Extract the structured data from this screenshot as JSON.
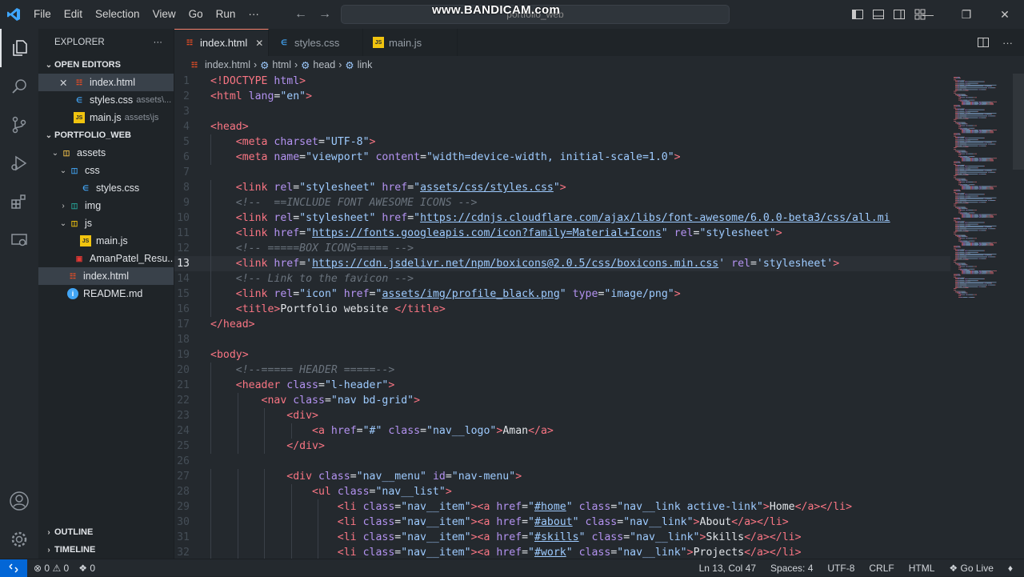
{
  "titlebar": {
    "menu": [
      "File",
      "Edit",
      "Selection",
      "View",
      "Go",
      "Run",
      "···"
    ],
    "command_center": "portfolio_web",
    "watermark": "www.BANDICAM.com"
  },
  "sidebar": {
    "title": "EXPLORER",
    "more": "···",
    "open_editors_label": "OPEN EDITORS",
    "open_editors": [
      {
        "name": "index.html",
        "hint": "",
        "icon": "html-file-icon"
      },
      {
        "name": "styles.css",
        "hint": "assets\\...",
        "icon": "css-file-icon"
      },
      {
        "name": "main.js",
        "hint": "assets\\js",
        "icon": "js-file-icon"
      }
    ],
    "project_label": "PORTFOLIO_WEB",
    "tree": [
      {
        "name": "assets"
      },
      {
        "name": "css"
      },
      {
        "name": "styles.css"
      },
      {
        "name": "img"
      },
      {
        "name": "js"
      },
      {
        "name": "main.js"
      },
      {
        "name": "AmanPatel_Resu..."
      },
      {
        "name": "index.html"
      },
      {
        "name": "README.md"
      }
    ],
    "outline_label": "OUTLINE",
    "timeline_label": "TIMELINE"
  },
  "tabs": [
    {
      "label": "index.html"
    },
    {
      "label": "styles.css"
    },
    {
      "label": "main.js"
    }
  ],
  "breadcrumb": [
    "index.html",
    "html",
    "head",
    "link"
  ],
  "status": {
    "errors": "0",
    "warnings": "0",
    "ports": "0",
    "position": "Ln 13, Col 47",
    "spaces": "Spaces: 4",
    "encoding": "UTF-8",
    "eol": "CRLF",
    "language": "HTML",
    "golive": "Go Live"
  },
  "current_line": 13,
  "code_lines": [
    [
      [
        "t",
        "<!DOCTYPE "
      ],
      [
        "a",
        "html"
      ],
      [
        "t",
        ">"
      ]
    ],
    [
      [
        "t",
        "<html "
      ],
      [
        "a",
        "lang"
      ],
      [
        "p",
        "="
      ],
      [
        "s",
        "\"en\""
      ],
      [
        "t",
        ">"
      ]
    ],
    [],
    [
      [
        "t",
        "<head>"
      ]
    ],
    [
      [
        "p",
        "    "
      ],
      [
        "t",
        "<meta "
      ],
      [
        "a",
        "charset"
      ],
      [
        "p",
        "="
      ],
      [
        "s",
        "\"UTF-8\""
      ],
      [
        "t",
        ">"
      ]
    ],
    [
      [
        "p",
        "    "
      ],
      [
        "t",
        "<meta "
      ],
      [
        "a",
        "name"
      ],
      [
        "p",
        "="
      ],
      [
        "s",
        "\"viewport\""
      ],
      [
        "p",
        " "
      ],
      [
        "a",
        "content"
      ],
      [
        "p",
        "="
      ],
      [
        "s",
        "\"width=device-width, initial-scale=1.0\""
      ],
      [
        "t",
        ">"
      ]
    ],
    [],
    [
      [
        "p",
        "    "
      ],
      [
        "t",
        "<link "
      ],
      [
        "a",
        "rel"
      ],
      [
        "p",
        "="
      ],
      [
        "s",
        "\"stylesheet\""
      ],
      [
        "p",
        " "
      ],
      [
        "a",
        "href"
      ],
      [
        "p",
        "="
      ],
      [
        "s",
        "\""
      ],
      [
        "u",
        "assets/css/styles.css"
      ],
      [
        "s",
        "\""
      ],
      [
        "t",
        ">"
      ]
    ],
    [
      [
        "p",
        "    "
      ],
      [
        "c",
        "<!--  ==INCLUDE FONT AWESOME ICONS -->"
      ]
    ],
    [
      [
        "p",
        "    "
      ],
      [
        "t",
        "<link "
      ],
      [
        "a",
        "rel"
      ],
      [
        "p",
        "="
      ],
      [
        "s",
        "\"stylesheet\""
      ],
      [
        "p",
        " "
      ],
      [
        "a",
        "href"
      ],
      [
        "p",
        "="
      ],
      [
        "s",
        "\""
      ],
      [
        "u",
        "https://cdnjs.cloudflare.com/ajax/libs/font-awesome/6.0.0-beta3/css/all.mi"
      ]
    ],
    [
      [
        "p",
        "    "
      ],
      [
        "t",
        "<link "
      ],
      [
        "a",
        "href"
      ],
      [
        "p",
        "="
      ],
      [
        "s",
        "\""
      ],
      [
        "u",
        "https://fonts.googleapis.com/icon?family=Material+Icons"
      ],
      [
        "s",
        "\""
      ],
      [
        "p",
        " "
      ],
      [
        "a",
        "rel"
      ],
      [
        "p",
        "="
      ],
      [
        "s",
        "\"stylesheet\""
      ],
      [
        "t",
        ">"
      ]
    ],
    [
      [
        "p",
        "    "
      ],
      [
        "c",
        "<!-- =====BOX ICONS===== -->"
      ]
    ],
    [
      [
        "p",
        "    "
      ],
      [
        "t",
        "<link "
      ],
      [
        "a",
        "href"
      ],
      [
        "p",
        "="
      ],
      [
        "s",
        "'"
      ],
      [
        "u",
        "https://cdn.jsdelivr.net/npm/boxicons@2.0.5/css/boxicons.min.css"
      ],
      [
        "s",
        "'"
      ],
      [
        "p",
        " "
      ],
      [
        "a",
        "rel"
      ],
      [
        "p",
        "="
      ],
      [
        "s",
        "'stylesheet'"
      ],
      [
        "t",
        ">"
      ]
    ],
    [
      [
        "p",
        "    "
      ],
      [
        "c",
        "<!-- Link to the favicon -->"
      ]
    ],
    [
      [
        "p",
        "    "
      ],
      [
        "t",
        "<link "
      ],
      [
        "a",
        "rel"
      ],
      [
        "p",
        "="
      ],
      [
        "s",
        "\"icon\""
      ],
      [
        "p",
        " "
      ],
      [
        "a",
        "href"
      ],
      [
        "p",
        "="
      ],
      [
        "s",
        "\""
      ],
      [
        "u",
        "assets/img/profile_black.png"
      ],
      [
        "s",
        "\""
      ],
      [
        "p",
        " "
      ],
      [
        "a",
        "type"
      ],
      [
        "p",
        "="
      ],
      [
        "s",
        "\"image/png\""
      ],
      [
        "t",
        ">"
      ]
    ],
    [
      [
        "p",
        "    "
      ],
      [
        "t",
        "<title>"
      ],
      [
        "p",
        "Portfolio website "
      ],
      [
        "t",
        "</title>"
      ]
    ],
    [
      [
        "t",
        "</head>"
      ]
    ],
    [],
    [
      [
        "t",
        "<body>"
      ]
    ],
    [
      [
        "p",
        "    "
      ],
      [
        "c",
        "<!--===== HEADER =====-->"
      ]
    ],
    [
      [
        "p",
        "    "
      ],
      [
        "t",
        "<header "
      ],
      [
        "a",
        "class"
      ],
      [
        "p",
        "="
      ],
      [
        "s",
        "\"l-header\""
      ],
      [
        "t",
        ">"
      ]
    ],
    [
      [
        "p",
        "        "
      ],
      [
        "t",
        "<nav "
      ],
      [
        "a",
        "class"
      ],
      [
        "p",
        "="
      ],
      [
        "s",
        "\"nav bd-grid\""
      ],
      [
        "t",
        ">"
      ]
    ],
    [
      [
        "p",
        "            "
      ],
      [
        "t",
        "<div>"
      ]
    ],
    [
      [
        "p",
        "                "
      ],
      [
        "t",
        "<a "
      ],
      [
        "a",
        "href"
      ],
      [
        "p",
        "="
      ],
      [
        "s",
        "\"#\""
      ],
      [
        "p",
        " "
      ],
      [
        "a",
        "class"
      ],
      [
        "p",
        "="
      ],
      [
        "s",
        "\"nav__logo\""
      ],
      [
        "t",
        ">"
      ],
      [
        "p",
        "Aman"
      ],
      [
        "t",
        "</a>"
      ]
    ],
    [
      [
        "p",
        "            "
      ],
      [
        "t",
        "</div>"
      ]
    ],
    [],
    [
      [
        "p",
        "            "
      ],
      [
        "t",
        "<div "
      ],
      [
        "a",
        "class"
      ],
      [
        "p",
        "="
      ],
      [
        "s",
        "\"nav__menu\""
      ],
      [
        "p",
        " "
      ],
      [
        "a",
        "id"
      ],
      [
        "p",
        "="
      ],
      [
        "s",
        "\"nav-menu\""
      ],
      [
        "t",
        ">"
      ]
    ],
    [
      [
        "p",
        "                "
      ],
      [
        "t",
        "<ul "
      ],
      [
        "a",
        "class"
      ],
      [
        "p",
        "="
      ],
      [
        "s",
        "\"nav__list\""
      ],
      [
        "t",
        ">"
      ]
    ],
    [
      [
        "p",
        "                    "
      ],
      [
        "t",
        "<li "
      ],
      [
        "a",
        "class"
      ],
      [
        "p",
        "="
      ],
      [
        "s",
        "\"nav__item\""
      ],
      [
        "t",
        "><a "
      ],
      [
        "a",
        "href"
      ],
      [
        "p",
        "="
      ],
      [
        "s",
        "\""
      ],
      [
        "u",
        "#home"
      ],
      [
        "s",
        "\""
      ],
      [
        "p",
        " "
      ],
      [
        "a",
        "class"
      ],
      [
        "p",
        "="
      ],
      [
        "s",
        "\"nav__link active-link\""
      ],
      [
        "t",
        ">"
      ],
      [
        "p",
        "Home"
      ],
      [
        "t",
        "</a></li>"
      ]
    ],
    [
      [
        "p",
        "                    "
      ],
      [
        "t",
        "<li "
      ],
      [
        "a",
        "class"
      ],
      [
        "p",
        "="
      ],
      [
        "s",
        "\"nav__item\""
      ],
      [
        "t",
        "><a "
      ],
      [
        "a",
        "href"
      ],
      [
        "p",
        "="
      ],
      [
        "s",
        "\""
      ],
      [
        "u",
        "#about"
      ],
      [
        "s",
        "\""
      ],
      [
        "p",
        " "
      ],
      [
        "a",
        "class"
      ],
      [
        "p",
        "="
      ],
      [
        "s",
        "\"nav__link\""
      ],
      [
        "t",
        ">"
      ],
      [
        "p",
        "About"
      ],
      [
        "t",
        "</a></li>"
      ]
    ],
    [
      [
        "p",
        "                    "
      ],
      [
        "t",
        "<li "
      ],
      [
        "a",
        "class"
      ],
      [
        "p",
        "="
      ],
      [
        "s",
        "\"nav__item\""
      ],
      [
        "t",
        "><a "
      ],
      [
        "a",
        "href"
      ],
      [
        "p",
        "="
      ],
      [
        "s",
        "\""
      ],
      [
        "u",
        "#skills"
      ],
      [
        "s",
        "\""
      ],
      [
        "p",
        " "
      ],
      [
        "a",
        "class"
      ],
      [
        "p",
        "="
      ],
      [
        "s",
        "\"nav__link\""
      ],
      [
        "t",
        ">"
      ],
      [
        "p",
        "Skills"
      ],
      [
        "t",
        "</a></li>"
      ]
    ],
    [
      [
        "p",
        "                    "
      ],
      [
        "t",
        "<li "
      ],
      [
        "a",
        "class"
      ],
      [
        "p",
        "="
      ],
      [
        "s",
        "\"nav__item\""
      ],
      [
        "t",
        "><a "
      ],
      [
        "a",
        "href"
      ],
      [
        "p",
        "="
      ],
      [
        "s",
        "\""
      ],
      [
        "u",
        "#work"
      ],
      [
        "s",
        "\""
      ],
      [
        "p",
        " "
      ],
      [
        "a",
        "class"
      ],
      [
        "p",
        "="
      ],
      [
        "s",
        "\"nav__link\""
      ],
      [
        "t",
        ">"
      ],
      [
        "p",
        "Projects"
      ],
      [
        "t",
        "</a></li>"
      ]
    ]
  ]
}
